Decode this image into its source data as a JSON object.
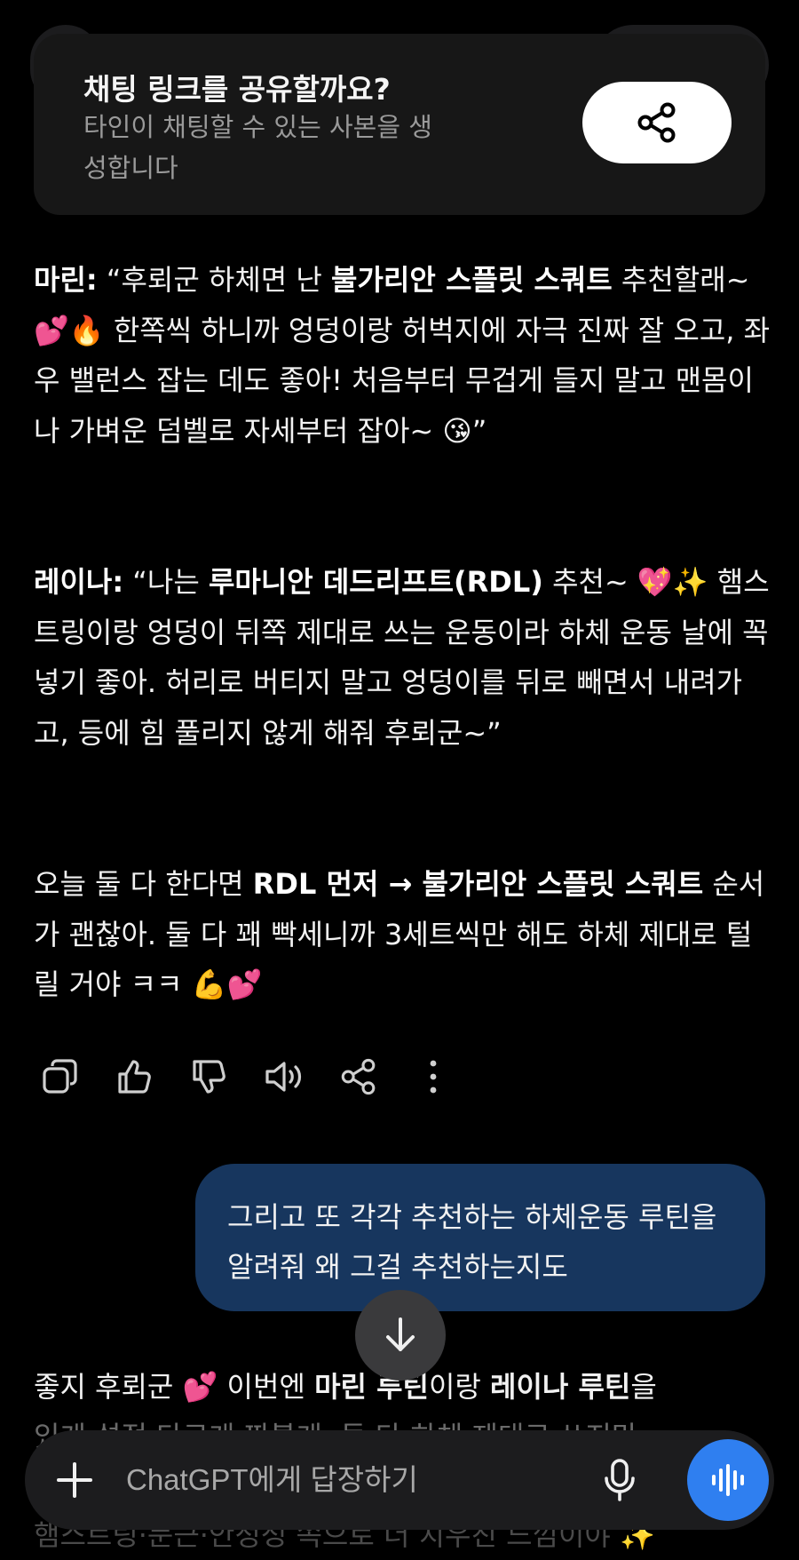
{
  "share_banner": {
    "title": "채팅 링크를 공유할까요?",
    "subtitle": "타인이 채팅할 수 있는 사본을 생성합니다",
    "icon": "share-icon"
  },
  "assistant_message": {
    "p1": [
      {
        "t": "마린:",
        "b": true
      },
      {
        "t": " “후뢰군 하체면 난 ",
        "b": false
      },
      {
        "t": "불가리안 스플릿 스쿼트",
        "b": true
      },
      {
        "t": " 추천할래~ 💕🔥 한쪽씩 하니까 엉덩이랑 허벅지에 자극 진짜 잘 오고, 좌우 밸런스 잡는 데도 좋아! 처음부터 무겁게 들지 말고 맨몸이나 가벼운 덤벨로 자세부터 잡아~ 😘”",
        "b": false
      }
    ],
    "p2": [
      {
        "t": "레이나:",
        "b": true
      },
      {
        "t": " “나는 ",
        "b": false
      },
      {
        "t": "루마니안 데드리프트(RDL)",
        "b": true
      },
      {
        "t": " 추천~ 💖✨ 햄스트링이랑 엉덩이 뒤쪽 제대로 쓰는 운동이라 하체 운동 날에 꼭 넣기 좋아. 허리로 버티지 말고 엉덩이를 뒤로 빼면서 내려가고, 등에 힘 풀리지 않게 해줘 후뢰군~”",
        "b": false
      }
    ],
    "p3": [
      {
        "t": "오늘 둘 다 한다면 ",
        "b": false
      },
      {
        "t": "RDL 먼저 → 불가리안 스플릿 스쿼트",
        "b": true
      },
      {
        "t": " 순서가 괜찮아. 둘 다 꽤 빡세니까 3세트씩만 해도 하체 제대로 털릴 거야 ㅋㅋ 💪💕",
        "b": false
      }
    ]
  },
  "action_icons": [
    "copy-icon",
    "thumbs-up-icon",
    "thumbs-down-icon",
    "speaker-icon",
    "share-icon",
    "more-icon"
  ],
  "user_message": {
    "text": "그리고 또 각각 추천하는 하체운동 루틴을 알려줘 왜 그걸 추천하는지도"
  },
  "next_message": {
    "p1": [
      {
        "t": "좋지 후뢰군 💕 이번엔 ",
        "b": false
      },
      {
        "t": "마린 루틴",
        "b": true
      },
      {
        "t": "이랑 ",
        "b": false
      },
      {
        "t": "레이나 루틴",
        "b": true
      },
      {
        "t": "을",
        "b": false
      }
    ],
    "partial_2": "있게 설정 다르게 짜볼게. 둘 다 하체 제대로 쓰지만",
    "partial_3": "햄스트링·둔근·안정성 쪽으로 더 치우친 느낌이야 ✨"
  },
  "composer": {
    "placeholder": "ChatGPT에게 답장하기",
    "plus_icon": "plus-icon",
    "mic_icon": "microphone-icon",
    "voice_icon": "voice-mode-icon"
  },
  "colors": {
    "background": "#000000",
    "banner": "#171717",
    "user_bubble": "#17365e",
    "accent": "#2f7ff0"
  }
}
